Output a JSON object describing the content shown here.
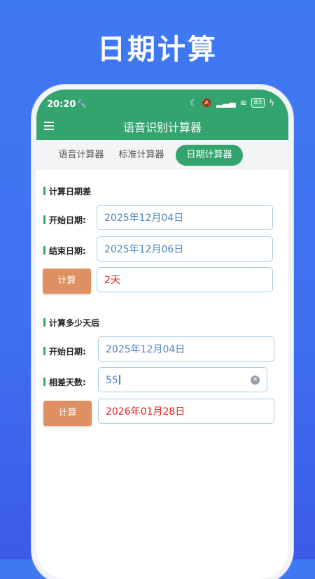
{
  "banner": {
    "title": "日期计算"
  },
  "status_bar": {
    "time": "20:20",
    "wrench_icon": "wrench-icon",
    "battery": "83"
  },
  "app_bar": {
    "title": "语音识别计算器"
  },
  "tabs": [
    {
      "label": "语音计算器",
      "active": false
    },
    {
      "label": "标准计算器",
      "active": false
    },
    {
      "label": "日期计算器",
      "active": true
    }
  ],
  "date_diff": {
    "section_title": "计算日期差",
    "start_label": "开始日期:",
    "start_value": "2025年12月04日",
    "end_label": "结束日期:",
    "end_value": "2025年12月06日",
    "calc_label": "计算",
    "result": "2天"
  },
  "date_after": {
    "section_title": "计算多少天后",
    "start_label": "开始日期:",
    "start_value": "2025年12月04日",
    "days_label": "相差天数:",
    "days_value": "55",
    "calc_label": "计算",
    "result": "2026年01月28日"
  },
  "colors": {
    "accent": "#33a46e",
    "button": "#df9062",
    "result": "#e02020",
    "background": "#3f79f2"
  }
}
